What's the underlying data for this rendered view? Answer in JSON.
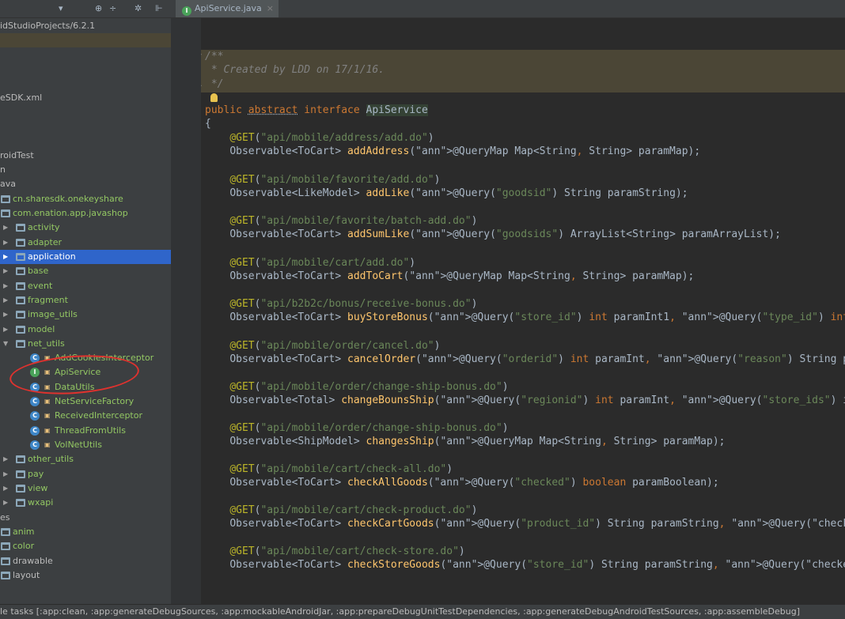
{
  "project_path": "idStudioProjects/6.2.1",
  "editor_tab": {
    "icon": "I",
    "label": "ApiService.java",
    "close": "×"
  },
  "toolbar_icons": {
    "dropdown": "▾",
    "gear": "⊕",
    "split": "÷",
    "settings": "✲",
    "collapse": "⊩"
  },
  "tree": {
    "items": [
      {
        "label": "eSDK.xml"
      },
      {
        "label": "roidTest"
      },
      {
        "label": "n"
      },
      {
        "label": "ava"
      },
      {
        "label": "cn.sharesdk.onekeyshare"
      },
      {
        "label": "com.enation.app.javashop"
      },
      {
        "label": "activity"
      },
      {
        "label": "adapter"
      },
      {
        "label": "application"
      },
      {
        "label": "base"
      },
      {
        "label": "event"
      },
      {
        "label": "fragment"
      },
      {
        "label": "image_utils"
      },
      {
        "label": "model"
      },
      {
        "label": "net_utils"
      },
      {
        "label": "AddCookiesInterceptor"
      },
      {
        "label": "ApiService"
      },
      {
        "label": "DataUtils"
      },
      {
        "label": "NetServiceFactory"
      },
      {
        "label": "ReceivedInterceptor"
      },
      {
        "label": "ThreadFromUtils"
      },
      {
        "label": "VolNetUtils"
      },
      {
        "label": "other_utils"
      },
      {
        "label": "pay"
      },
      {
        "label": "view"
      },
      {
        "label": "wxapi"
      },
      {
        "label": "es"
      },
      {
        "label": "anim"
      },
      {
        "label": "color"
      },
      {
        "label": "drawable"
      },
      {
        "label": "layout"
      }
    ]
  },
  "code": {
    "comment": [
      "/**",
      " * Created by LDD on 17/1/16.",
      " */"
    ],
    "decl": {
      "public": "public",
      "abstract": "abstract",
      "interface": "interface",
      "name": "ApiService"
    },
    "open_brace": "{",
    "methods": [
      {
        "get": "\"api/mobile/address/add.do\"",
        "ret": "Observable<ToCart>",
        "name": "addAddress",
        "args": "@QueryMap Map<String, String> paramMap);"
      },
      {
        "get": "\"api/mobile/favorite/add.do\"",
        "ret": "Observable<LikeModel>",
        "name": "addLike",
        "args": "@Query(\"goodsid\") String paramString);"
      },
      {
        "get": "\"api/mobile/favorite/batch-add.do\"",
        "ret": "Observable<ToCart>",
        "name": "addSumLike",
        "args": "@Query(\"goodsids\") ArrayList<String> paramArrayList);"
      },
      {
        "get": "\"api/mobile/cart/add.do\"",
        "ret": "Observable<ToCart>",
        "name": "addToCart",
        "args": "@QueryMap Map<String, String> paramMap);"
      },
      {
        "get": "\"api/b2b2c/bonus/receive-bonus.do\"",
        "ret": "Observable<ToCart>",
        "name": "buyStoreBonus",
        "args": "@Query(\"store_id\") int paramInt1, @Query(\"type_id\") int"
      },
      {
        "get": "\"api/mobile/order/cancel.do\"",
        "ret": "Observable<ToCart>",
        "name": "cancelOrder",
        "args": "@Query(\"orderid\") int paramInt, @Query(\"reason\") String p"
      },
      {
        "get": "\"api/mobile/order/change-ship-bonus.do\"",
        "ret": "Observable<Total>",
        "name": "changeBounsShip",
        "args": "@Query(\"regionid\") int paramInt, @Query(\"store_ids\") i"
      },
      {
        "get": "\"api/mobile/order/change-ship-bonus.do\"",
        "ret": "Observable<ShipModel>",
        "name": "changesShip",
        "args": "@QueryMap Map<String, String> paramMap);"
      },
      {
        "get": "\"api/mobile/cart/check-all.do\"",
        "ret": "Observable<ToCart>",
        "name": "checkAllGoods",
        "args": "@Query(\"checked\") boolean paramBoolean);"
      },
      {
        "get": "\"api/mobile/cart/check-product.do\"",
        "ret": "Observable<ToCart>",
        "name": "checkCartGoods",
        "args": "@Query(\"product_id\") String paramString, @Query(\"check"
      },
      {
        "get": "\"api/mobile/cart/check-store.do\"",
        "ret": "Observable<ToCart>",
        "name": "checkStoreGoods",
        "args": "@Query(\"store_id\") String paramString, @Query(\"checke"
      }
    ]
  },
  "status_bar": "le tasks [:app:clean, :app:generateDebugSources, :app:mockableAndroidJar, :app:prepareDebugUnitTestDependencies, :app:generateDebugAndroidTestSources, :app:assembleDebug]"
}
